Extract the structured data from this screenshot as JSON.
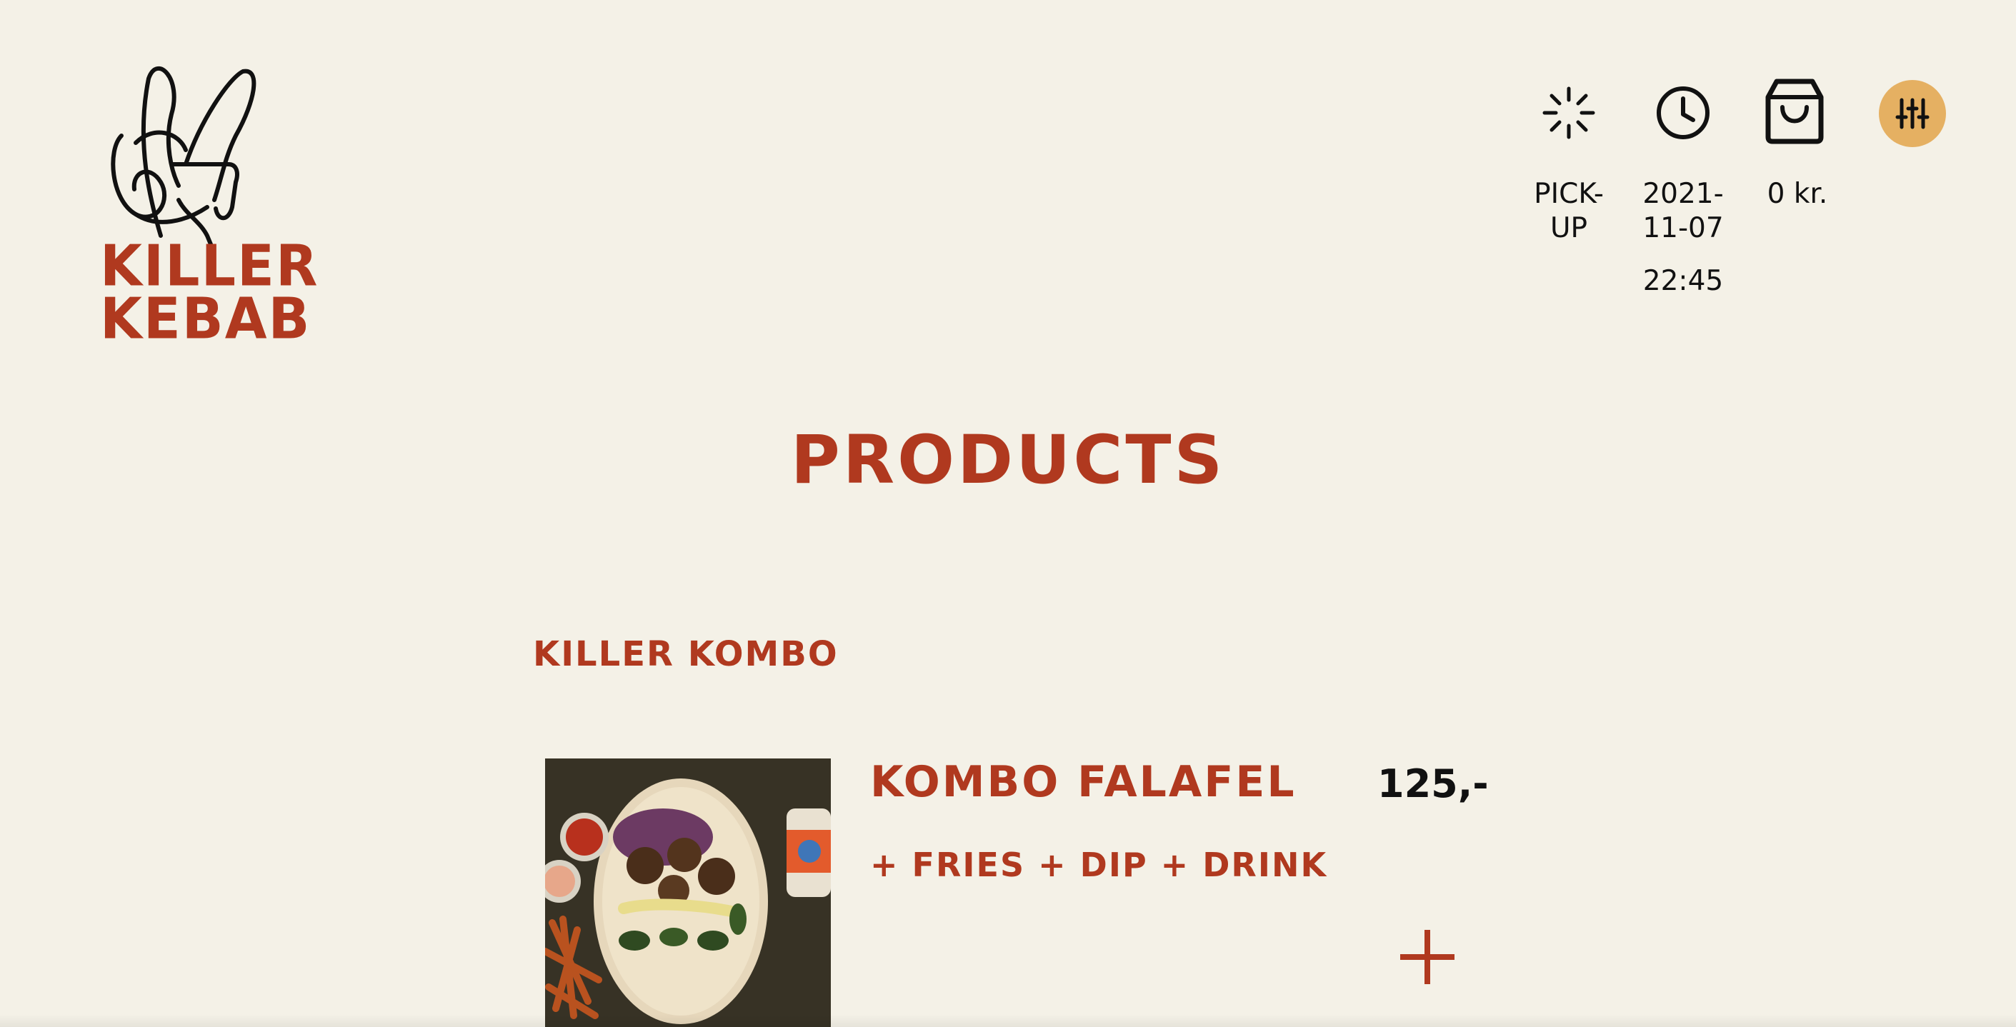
{
  "brand": {
    "line1": "KILLER",
    "line2": "KEBAB",
    "color": "#b0391f"
  },
  "header": {
    "order_type": {
      "label": "PICK-UP",
      "icon": "loading-sun-icon"
    },
    "datetime": {
      "date_line1": "2021-",
      "date_line2": "11-07",
      "time": "22:45",
      "icon": "clock-icon"
    },
    "cart": {
      "total": "0 kr.",
      "icon": "shopping-bag-icon"
    },
    "filter": {
      "icon": "sliders-icon",
      "color": "#e5b062"
    }
  },
  "page": {
    "title": "PRODUCTS"
  },
  "categories": [
    {
      "title": "KILLER KOMBO",
      "products": [
        {
          "name": "KOMBO FALAFEL",
          "description": "+ FRIES + DIP + DRINK",
          "price": "125,-",
          "add_icon": "plus-icon"
        }
      ]
    }
  ]
}
